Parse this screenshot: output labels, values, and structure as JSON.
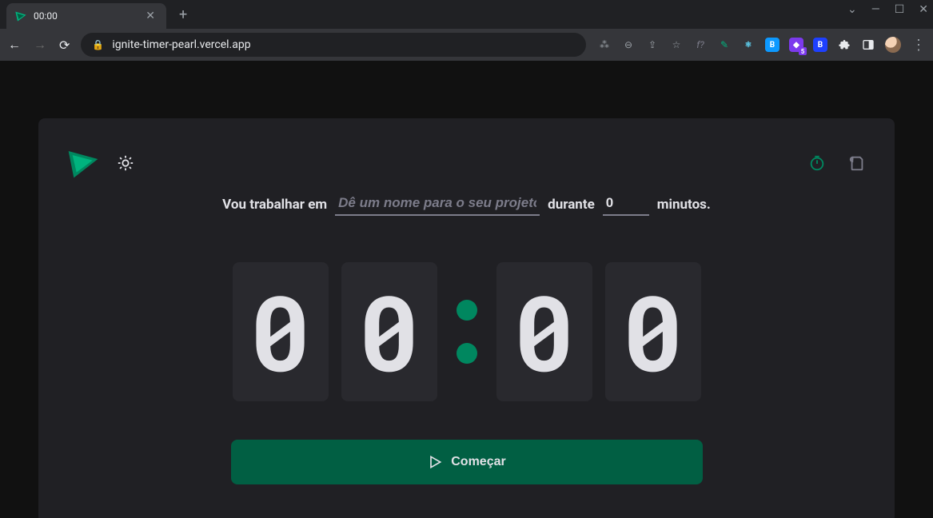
{
  "browser": {
    "tab_title": "00:00",
    "url": "ignite-timer-pearl.vercel.app"
  },
  "app": {
    "form": {
      "prefix_label": "Vou trabalhar em",
      "task_placeholder": "Dê um nome para o seu projeto",
      "task_value": "",
      "duration_label": "durante",
      "minutes_value": "0",
      "minutes_suffix": "minutos."
    },
    "countdown": {
      "d1": "0",
      "d2": "0",
      "d3": "0",
      "d4": "0"
    },
    "start_button_label": "Começar",
    "colors": {
      "accent": "#00875F",
      "accent_dark": "#015F43",
      "card_bg": "#202024",
      "digit_bg": "#29292E",
      "page_bg": "#111111"
    }
  }
}
